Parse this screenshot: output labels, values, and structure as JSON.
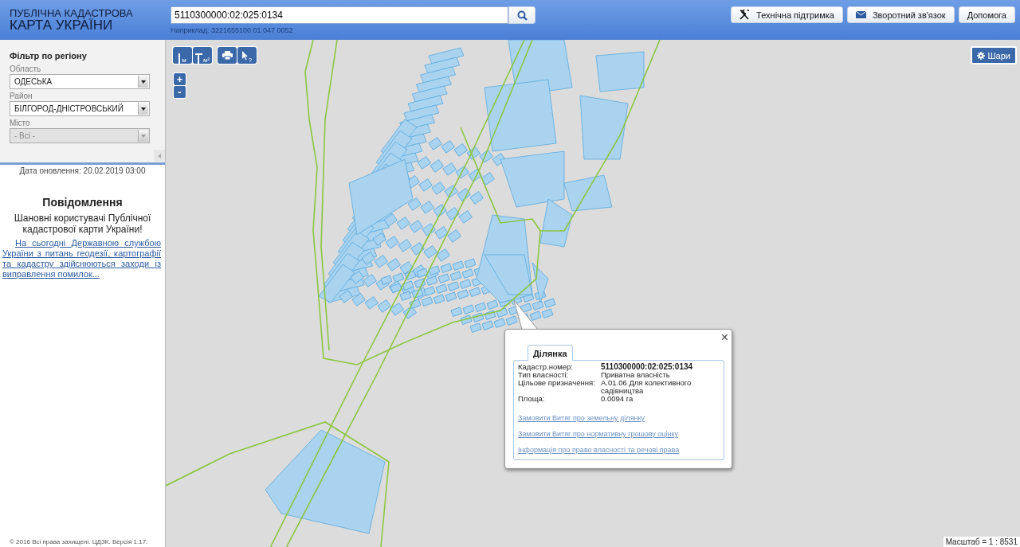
{
  "header": {
    "logo_line1": "ПУБЛІЧНА КАДАСТРОВА",
    "logo_line2": "КАРТА УКРАЇНИ",
    "search": {
      "value": "5110300000:02:025:0134",
      "hint": "Наприклад: 3221655100 01 047 0052"
    },
    "buttons": [
      {
        "kind": "tools",
        "label": "Технічна підтримка"
      },
      {
        "kind": "mail",
        "label": "Зворотний зв'язок"
      },
      {
        "kind": "plain",
        "label": "Допомога"
      }
    ]
  },
  "sidebar": {
    "filter_title": "Фільтр по регіону",
    "fields": [
      {
        "label": "Область",
        "value": "ОДЕСЬКА",
        "disabled": false
      },
      {
        "label": "Район",
        "value": "БІЛГОРОД-ДНІСТРОВСЬКИЙ",
        "disabled": false
      },
      {
        "label": "Місто",
        "value": "- Всі -",
        "disabled": true
      }
    ],
    "update_date": "Дата оновлення: 20.02.2019 03:00",
    "notice": {
      "title": "Повідомлення",
      "greeting": "Шановні користувачі Публічної кадастрової карти України!",
      "link": "На сьогодні Державною службою України з питань геодезії, картографії та кадастру здійснюються заходи із виправлення помилок..."
    },
    "footer": "© 2016 Всі права захищені. ЦДЗК. Версія 1.17."
  },
  "map": {
    "tools": [
      {
        "kind": "length",
        "label": "м"
      },
      {
        "kind": "area",
        "label": "м²"
      },
      {
        "kind": "print"
      },
      {
        "kind": "identify",
        "label": "?"
      }
    ],
    "zoom": [
      "+",
      "-"
    ],
    "layers_button": "Шари",
    "scale": "Масштаб = 1 : 8531",
    "popup": {
      "close": "×",
      "tab": "Ділянка",
      "rows": [
        {
          "label": "Кадастр.номер:",
          "value": "5110300000:02:025:0134",
          "bold": true
        },
        {
          "label": "Тип власності:",
          "value": "Приватна власність",
          "bold": false
        },
        {
          "label": "Цільове призначення:",
          "value": "А.01.06 Для колективного садівництва",
          "bold": false
        },
        {
          "label": "Площа:",
          "value": "0.0094 га",
          "bold": false
        }
      ],
      "links": [
        "Замовити Витяг про земельну ділянку",
        "Замовити Витяг про нормативну грошову оцінку",
        "Інформація про право власності та речові права"
      ]
    }
  }
}
